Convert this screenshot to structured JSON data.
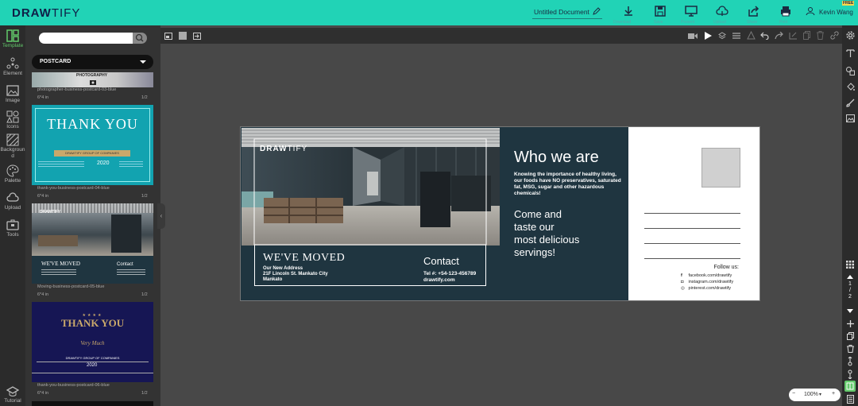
{
  "app": {
    "logo_bold": "DRAW",
    "logo_light": "TIFY",
    "document_title": "Untitled Document",
    "free_badge": "FREE",
    "user_name": "Kevin Wang",
    "toolbar": [
      {
        "name": "download-icon",
        "caption": "Download"
      },
      {
        "name": "save-icon",
        "caption": "Save"
      },
      {
        "name": "present-icon",
        "caption": "Present"
      },
      {
        "name": "cloud-icon",
        "caption": "Upload"
      },
      {
        "name": "share-icon",
        "caption": "Share"
      },
      {
        "name": "print-icon",
        "caption": "Print"
      }
    ]
  },
  "rail": {
    "items": [
      {
        "label": "Template",
        "icon": "template-icon",
        "active": true
      },
      {
        "label": "Element",
        "icon": "element-icon"
      },
      {
        "label": "Image",
        "icon": "image-icon"
      },
      {
        "label": "Icons",
        "icon": "icons-icon"
      },
      {
        "label": "Backgroun\nd",
        "icon": "background-icon"
      },
      {
        "label": "Palette",
        "icon": "palette-icon"
      },
      {
        "label": "Upload",
        "icon": "upload-icon"
      },
      {
        "label": "Tools",
        "icon": "tools-icon"
      },
      {
        "label": "Tutorial",
        "icon": "tutorial-icon"
      }
    ]
  },
  "panel": {
    "search_placeholder": "",
    "category": "POSTCARD",
    "templates": [
      {
        "name": "photographer-business-postcard-03-blue",
        "size": "6*4 in",
        "pages": "1/2",
        "thumb_text": "PHOTOGRAPHY"
      },
      {
        "name": "thank-you-business-postcard-04-blue",
        "size": "6*4 in",
        "pages": "1/2",
        "thumb_text": "THANK YOU",
        "thumb_sub": "DRAWTIFY GROUP OF COMPANIES",
        "thumb_year": "2020"
      },
      {
        "name": "Moving-business-postcard-05-blue",
        "size": "6*4 in",
        "pages": "1/2",
        "thumb_text": "WE'VE MOVED",
        "thumb_contact": "Contact"
      },
      {
        "name": "thank-you-business-postcard-06-blue",
        "size": "6*4 in",
        "pages": "1/2",
        "thumb_text": "THANK YOU",
        "thumb_script": "Very Much",
        "thumb_sub": "DRAWTIFY GROUP OF COMPANIES",
        "thumb_year": "2020"
      }
    ]
  },
  "postcard": {
    "logo_bold": "DRAW",
    "logo_light": "TIFY",
    "moved_title": "WE'VE MOVED",
    "address_label": "Our New Address",
    "address_line1": "21F Lincoln St. Mankato City",
    "address_line2": "Mankato",
    "contact_title": "Contact",
    "contact_tel": "Tel #: +54-123-456789",
    "contact_web": "drawtify.com",
    "who_title": "Who we are",
    "who_body": "Knowing the importance of healthy living, our foods have NO preservatives, saturated fat, MSG, sugar and other hazardous chemicals!",
    "come_line1": "Come and",
    "come_line2": "taste our",
    "come_line3": "most delicious",
    "come_line4": "servings!",
    "follow_label": "Follow us:",
    "social": [
      {
        "icon": "facebook-icon",
        "text": "facebook.com/drawtify"
      },
      {
        "icon": "instagram-icon",
        "text": "instagram.com/drawtify"
      },
      {
        "icon": "pinterest-icon",
        "text": "pinterest.com/drawtify"
      }
    ]
  },
  "pager": {
    "current": "1",
    "sep": "/",
    "total": "2"
  },
  "zoom": {
    "minus": "−",
    "value": "100%",
    "caret": "▾",
    "plus": "+"
  },
  "colors": {
    "accent": "#21d3b6",
    "brand_navy": "#0f1f47",
    "card_dark": "#1f3540",
    "active_green": "#63c96b"
  }
}
